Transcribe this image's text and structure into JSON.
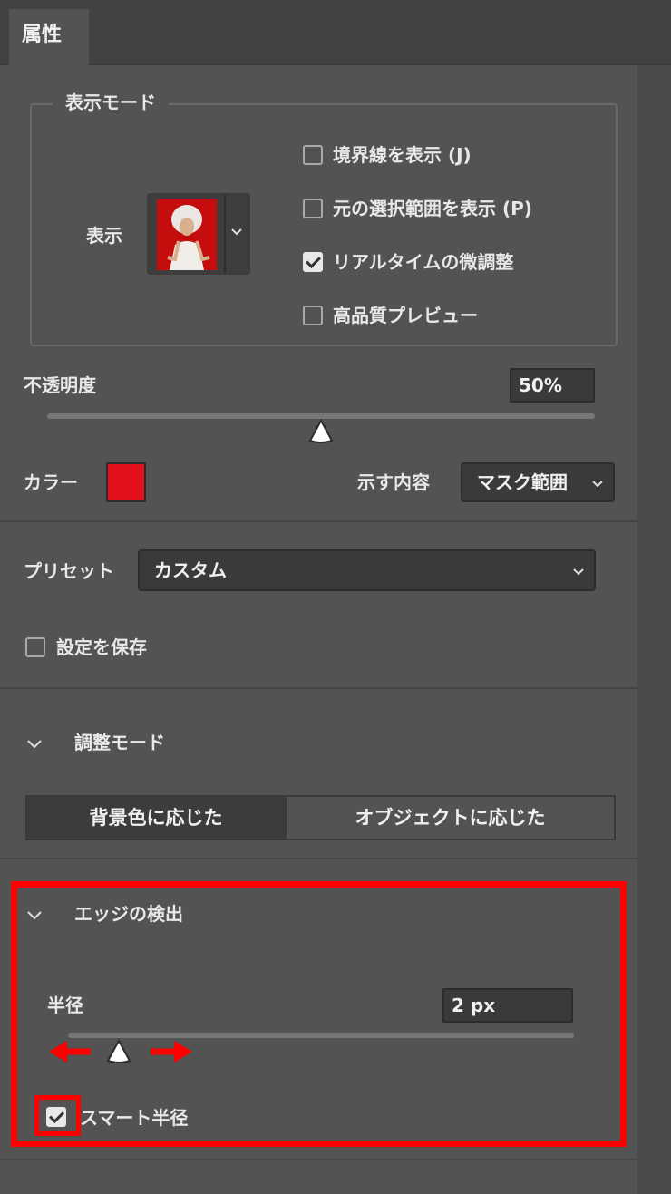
{
  "panel": {
    "tab_label": "属性"
  },
  "view_mode": {
    "legend": "表示モード",
    "view_label": "表示",
    "options": [
      {
        "label": "境界線を表示 (J)",
        "checked": false
      },
      {
        "label": "元の選択範囲を表示 (P)",
        "checked": false
      },
      {
        "label": "リアルタイムの微調整",
        "checked": true
      },
      {
        "label": "高品質プレビュー",
        "checked": false
      }
    ]
  },
  "opacity": {
    "label": "不透明度",
    "value": "50%",
    "fraction": 0.5
  },
  "color": {
    "label": "カラー",
    "swatch_hex": "#e3101b"
  },
  "indicates": {
    "label": "示す内容",
    "value": "マスク範囲"
  },
  "preset": {
    "label": "プリセット",
    "value": "カスタム"
  },
  "save_settings": {
    "label": "設定を保存",
    "checked": false
  },
  "refine_mode": {
    "title": "調整モード",
    "options": [
      "背景色に応じた",
      "オブジェクトに応じた"
    ],
    "selected_index": 0
  },
  "edge_detection": {
    "title": "エッジの検出",
    "radius_label": "半径",
    "radius_value": "2 px",
    "radius_fraction": 0.1,
    "smart_radius_label": "スマート半径",
    "smart_radius_checked": true
  },
  "colors": {
    "panel_bg": "#535353",
    "field_bg": "#3a3a3a",
    "highlight": "#ff0000"
  }
}
